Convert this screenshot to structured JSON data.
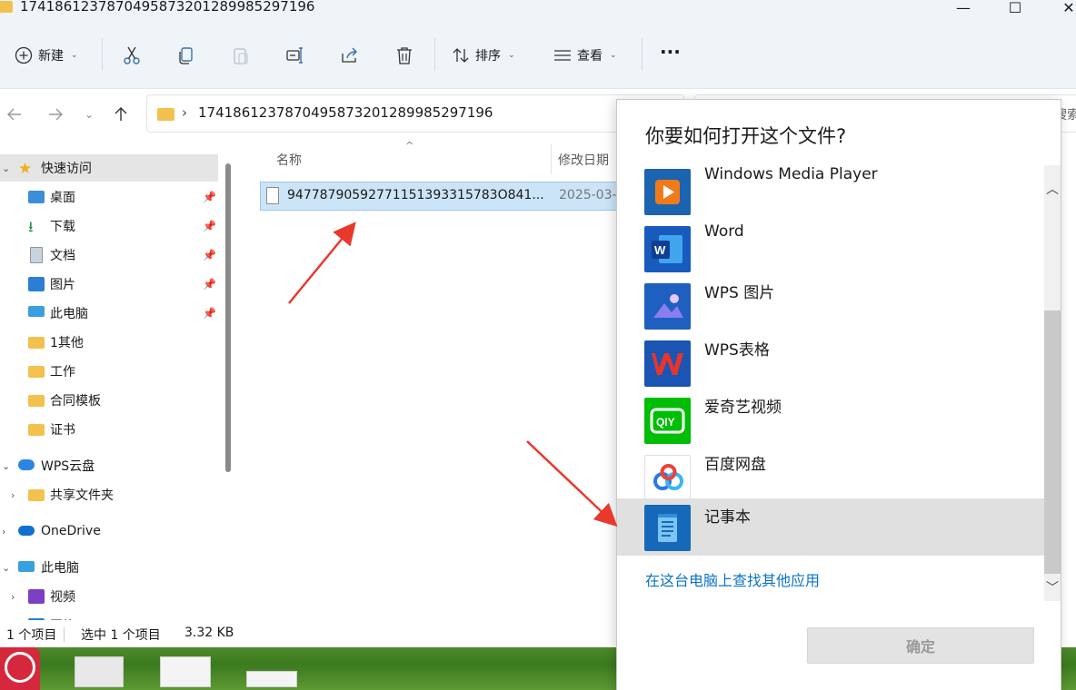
{
  "window": {
    "title": "17418612378704958732012899852971​96",
    "controls": {
      "minimize": "—",
      "maximize": "☐",
      "close": "✕"
    }
  },
  "toolbar": {
    "new_label": "新建",
    "sort_label": "排序",
    "view_label": "查看",
    "more_label": "···",
    "icons": [
      "cut-icon",
      "copy-icon",
      "paste-icon",
      "rename-icon",
      "share-icon",
      "delete-icon"
    ]
  },
  "address": {
    "path": "1741861237870495873201289985297196",
    "search_placeholder": "搜索"
  },
  "sidebar": {
    "quick_access": "快速访问",
    "items": [
      {
        "label": "桌面",
        "icon": "desktop-icon",
        "pinned": true
      },
      {
        "label": "下载",
        "icon": "download-icon",
        "pinned": true
      },
      {
        "label": "文档",
        "icon": "document-icon",
        "pinned": true
      },
      {
        "label": "图片",
        "icon": "pictures-icon",
        "pinned": true
      },
      {
        "label": "此电脑",
        "icon": "computer-icon",
        "pinned": true
      },
      {
        "label": "1其他",
        "icon": "folder-icon",
        "pinned": false
      },
      {
        "label": "工作",
        "icon": "folder-icon",
        "pinned": false
      },
      {
        "label": "合同模板",
        "icon": "folder-icon",
        "pinned": false
      },
      {
        "label": "证书",
        "icon": "folder-icon",
        "pinned": false
      }
    ],
    "wps_cloud": "WPS云盘",
    "shared_folder": "共享文件夹",
    "onedrive": "OneDrive",
    "this_pc": "此电脑",
    "videos": "视频",
    "partial": "图片"
  },
  "filelist": {
    "columns": {
      "name": "名称",
      "modified": "修改日期"
    },
    "files": [
      {
        "name": "94778790592771151393315783O841...",
        "date": "2025-03-"
      }
    ]
  },
  "status": {
    "count": "1 个项目",
    "selected": "选中 1 个项目",
    "size": "3.32 KB"
  },
  "dialog": {
    "title": "你要如何打开这个文件?",
    "apps": [
      {
        "name": "Windows Media Player",
        "icon": "media-player-icon",
        "color": "#1d64b0"
      },
      {
        "name": "Word",
        "icon": "word-icon",
        "color": "#185abd"
      },
      {
        "name": "WPS 图片",
        "icon": "wps-pictures-icon",
        "color": "#1f5fbf"
      },
      {
        "name": "WPS表格",
        "icon": "wps-spreadsheet-icon",
        "color": "#1a55b3"
      },
      {
        "name": "爱奇艺视频",
        "icon": "iqiyi-icon",
        "color": "#00be06"
      },
      {
        "name": "百度网盘",
        "icon": "baidu-netdisk-icon",
        "color": "#2a79e8"
      },
      {
        "name": "记事本",
        "icon": "notepad-icon",
        "color": "#1569b8",
        "selected": true
      }
    ],
    "find_more": "在这台电脑上查找其他应用",
    "ok_label": "确定"
  },
  "colors": {
    "selection_bg": "#cce4f7",
    "link": "#0a73c8",
    "arrow": "#e8392c"
  }
}
